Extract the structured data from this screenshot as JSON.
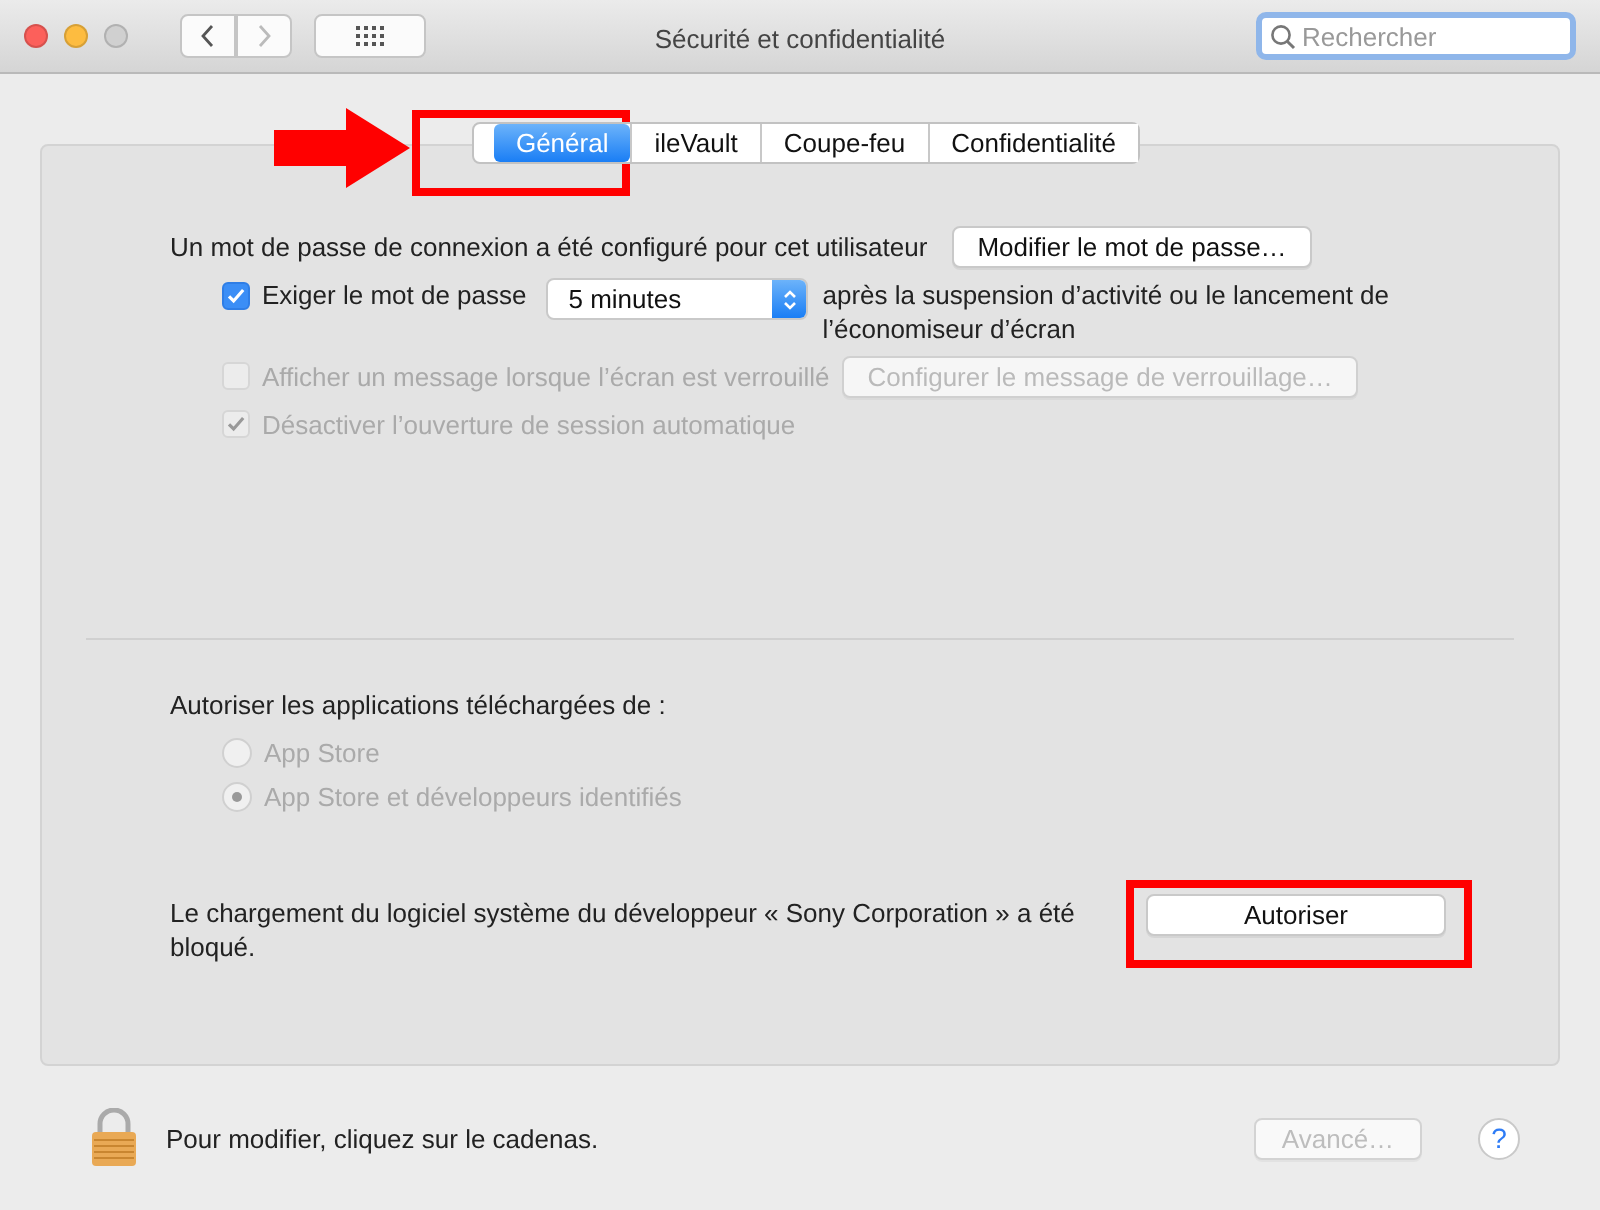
{
  "window": {
    "title": "Sécurité et confidentialité"
  },
  "search": {
    "placeholder": "Rechercher"
  },
  "tabs": [
    {
      "label": "Général",
      "selected": true
    },
    {
      "label": "ileVault",
      "selected": false
    },
    {
      "label": "Coupe-feu",
      "selected": false
    },
    {
      "label": "Confidentialité",
      "selected": false
    }
  ],
  "password": {
    "message": "Un mot de passe de connexion a été configuré pour cet utilisateur",
    "change_button": "Modifier le mot de passe…",
    "options": [
      {
        "kind": "require",
        "label": "Exiger le mot de passe",
        "checked": true,
        "disabled": false,
        "delay": "5 minutes",
        "suffix": "après la suspension d’activité ou le lancement de l’économiseur d’écran"
      },
      {
        "kind": "button",
        "label": "Afficher un message lorsque l’écran est verrouillé",
        "checked": false,
        "disabled": true,
        "button": "Configurer le message de verrouillage…"
      },
      {
        "kind": "plain",
        "label": "Désactiver l’ouverture de session automatique",
        "checked": true,
        "disabled": true
      }
    ]
  },
  "downloads": {
    "label": "Autoriser les applications téléchargées de :",
    "options": [
      {
        "label": "App Store",
        "selected": false,
        "disabled": true
      },
      {
        "label": "App Store et développeurs identifiés",
        "selected": true,
        "disabled": true
      }
    ]
  },
  "blocked": {
    "message": "Le chargement du logiciel système du développeur « Sony Corporation » a été bloqué.",
    "button": "Autoriser"
  },
  "footer": {
    "lock_message": "Pour modifier, cliquez sur le cadenas.",
    "advanced_button": {
      "label": "Avancé…",
      "disabled": true
    },
    "help": "?"
  },
  "annotations": [
    {
      "kind": "arrow"
    },
    {
      "kind": "frame"
    },
    {
      "kind": "frame"
    }
  ]
}
